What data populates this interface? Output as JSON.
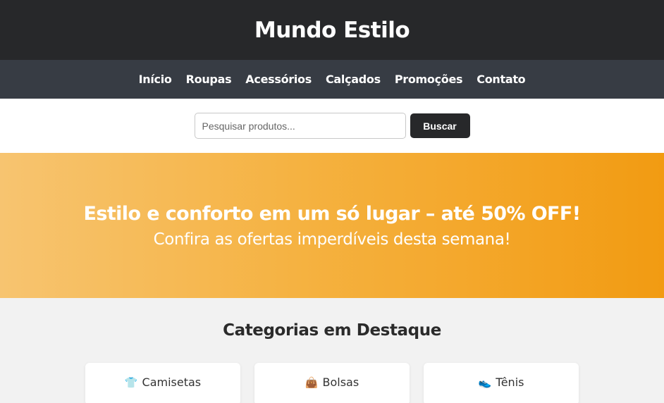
{
  "header": {
    "title": "Mundo Estilo"
  },
  "nav": {
    "items": [
      {
        "label": "Início"
      },
      {
        "label": "Roupas"
      },
      {
        "label": "Acessórios"
      },
      {
        "label": "Calçados"
      },
      {
        "label": "Promoções"
      },
      {
        "label": "Contato"
      }
    ]
  },
  "search": {
    "placeholder": "Pesquisar produtos...",
    "value": "",
    "button_label": "Buscar"
  },
  "hero": {
    "title": "Estilo e conforto em um só lugar – até 50% OFF!",
    "subtitle": "Confira as ofertas imperdíveis desta semana!"
  },
  "categories": {
    "title": "Categorias em Destaque",
    "items": [
      {
        "icon": "shirt-icon",
        "glyph": "👕",
        "label": "Camisetas"
      },
      {
        "icon": "handbag-icon",
        "glyph": "👜",
        "label": "Bolsas"
      },
      {
        "icon": "sneaker-icon",
        "glyph": "👟",
        "label": "Tênis"
      }
    ]
  },
  "colors": {
    "header_bg": "#27282a",
    "nav_bg": "#373c44",
    "hero_gradient_start": "#f7c470",
    "hero_gradient_end": "#f29b12",
    "button_bg": "#27282a"
  }
}
